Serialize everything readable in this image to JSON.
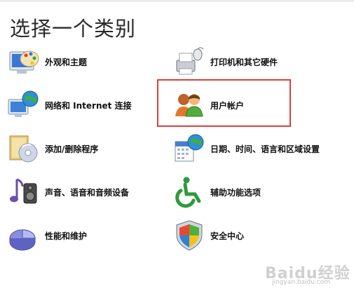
{
  "window": {
    "title": "选择一个类别"
  },
  "categories_left": [
    {
      "label": "外观和主题",
      "icon": "appearance-themes-icon"
    },
    {
      "label": "网络和 Internet 连接",
      "icon": "network-internet-icon"
    },
    {
      "label": "添加/删除程序",
      "icon": "add-remove-programs-icon"
    },
    {
      "label": "声音、语音和音频设备",
      "icon": "sounds-audio-icon"
    },
    {
      "label": "性能和维护",
      "icon": "performance-maintenance-icon"
    }
  ],
  "categories_right": [
    {
      "label": "打印机和其它硬件",
      "icon": "printers-hardware-icon"
    },
    {
      "label": "用户帐户",
      "icon": "user-accounts-icon"
    },
    {
      "label": "日期、时间、语言和区域设置",
      "icon": "date-time-region-icon"
    },
    {
      "label": "辅助功能选项",
      "icon": "accessibility-icon"
    },
    {
      "label": "安全中心",
      "icon": "security-center-icon"
    }
  ],
  "highlight_color": "#d9403a",
  "watermark": {
    "text": "Baidu经验",
    "subtext": "jingyan.baidu.com"
  }
}
